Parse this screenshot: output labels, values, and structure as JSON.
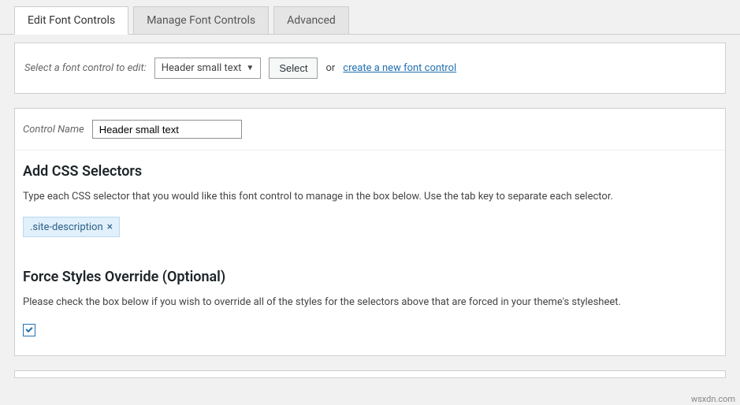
{
  "tabs": {
    "edit": "Edit Font Controls",
    "manage": "Manage Font Controls",
    "advanced": "Advanced"
  },
  "selector": {
    "label": "Select a font control to edit:",
    "selected": "Header small text",
    "button": "Select",
    "or": "or",
    "create_link": "create a new font control"
  },
  "control_name": {
    "label": "Control Name",
    "value": "Header small text"
  },
  "css_section": {
    "title": "Add CSS Selectors",
    "desc": "Type each CSS selector that you would like this font control to manage in the box below. Use the tab key to separate each selector.",
    "tag": ".site-description"
  },
  "override_section": {
    "title": "Force Styles Override (Optional)",
    "desc": "Please check the box below if you wish to override all of the styles for the selectors above that are forced in your theme's stylesheet."
  },
  "watermark": "wsxdn.com"
}
